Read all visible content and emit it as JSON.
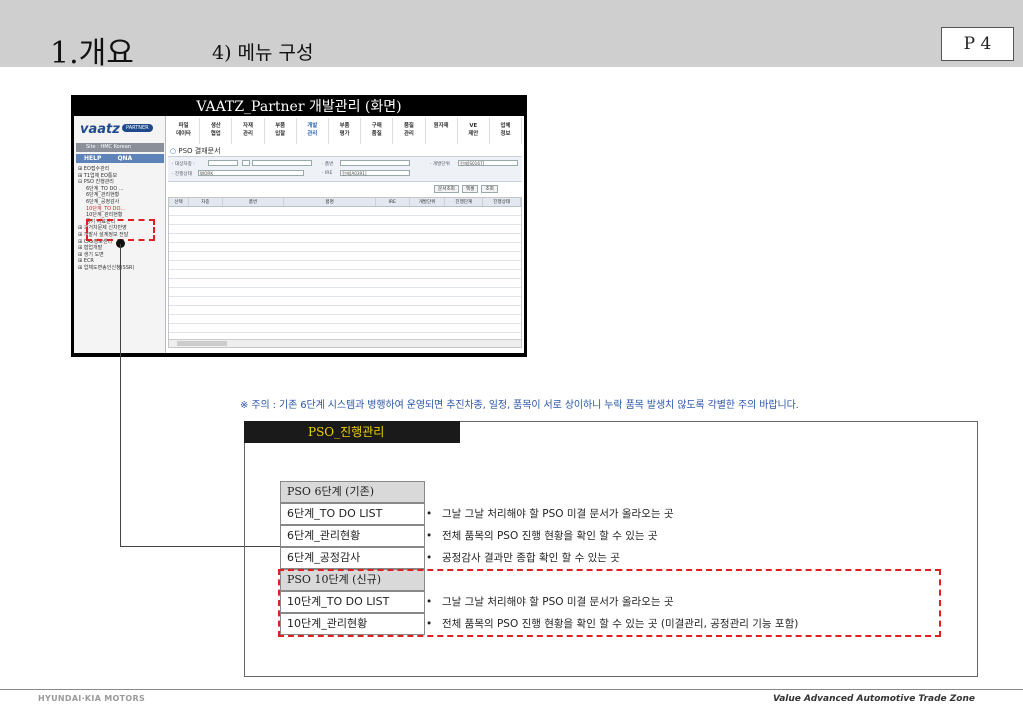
{
  "header": {
    "title": "1.개요",
    "subtitle": "4) 메뉴 구성",
    "page": "P 4"
  },
  "app": {
    "window_title": "VAATZ_Partner 개발관리 (화면)",
    "logo": "vaatz",
    "logo_tag": "PARTNER",
    "site": "Site : HMC Korean",
    "help": "HELP",
    "qna": "QNA",
    "menu": [
      "파일\n데이타",
      "생산\n협업",
      "자재\n관리",
      "부품\n입찰",
      "개발\n관리",
      "부품\n평가",
      "구매\n품질",
      "품질\n관리",
      "원자재",
      "VE\n제안",
      "업체\n정보"
    ],
    "section_title": "PSO 결재문서",
    "tree": [
      {
        "label": "⊞ EO접수관리",
        "level": 0
      },
      {
        "label": "⊞ T1업체 EO통보",
        "level": 0
      },
      {
        "label": "⊟ PSO 진행관리",
        "level": 0
      },
      {
        "label": "6단계_TO DO ...",
        "level": 1
      },
      {
        "label": "6단계_관리현황",
        "level": 1
      },
      {
        "label": "6단계_공정감사",
        "level": 1
      },
      {
        "label": "10단계_TO DO...",
        "level": 1,
        "red": true
      },
      {
        "label": "10단계_관리현황",
        "level": 1
      },
      {
        "label": "공기 자료관리",
        "level": 1
      },
      {
        "label": "⊞ 과거차문제 신차반영",
        "level": 0
      },
      {
        "label": "⊞ 개발사 설계정보 전달",
        "level": 0
      },
      {
        "label": "⊞ CAx정보센터",
        "level": 0
      },
      {
        "label": "⊞ 협업개발",
        "level": 0
      },
      {
        "label": "⊞ 생기 도면",
        "level": 0
      },
      {
        "label": "⊞ ECR",
        "level": 0
      },
      {
        "label": "⊞ 업체도면송인신청(SSR)",
        "level": 0
      }
    ],
    "filters": {
      "vehicle_label": "· 대상차종 :",
      "status_label": "· 진행상태",
      "status_value": "WORK",
      "part_label": "· 품번",
      "ire_label": "· IRE",
      "ire_value": "전체[A0391]",
      "dev_unit_label": "· 개발단위",
      "dev_unit_value": "전체[S0167]"
    },
    "buttons": [
      "문서조회",
      "엑셀",
      "조회"
    ],
    "columns": [
      "선택",
      "차종",
      "품번",
      "품명",
      "IRE",
      "개발단위",
      "진행단계",
      "진행상태"
    ]
  },
  "notice": "※ 주의 : 기존 6단계 시스템과 병행하여 운영되면 추진차종, 일정, 품목이 서로 상이하니 누락 품목 발생치 않도록 각별한 주의 바랍니다.",
  "panel": {
    "tab": "PSO_진행관리",
    "rows": [
      {
        "label": "PSO 6단계 (기존)",
        "header": true,
        "desc": ""
      },
      {
        "label": "6단계_TO DO LIST",
        "header": false,
        "desc": "그날 그날 처리해야 할 PSO 미결 문서가 올라오는 곳"
      },
      {
        "label": "6단계_관리현황",
        "header": false,
        "desc": "전체 품목의 PSO 진행 현황을 확인 할 수 있는 곳"
      },
      {
        "label": "6단계_공정감사",
        "header": false,
        "desc": "공정감사 결과만 종합 확인 할 수 있는 곳"
      },
      {
        "label": "PSO 10단계 (신규)",
        "header": true,
        "desc": ""
      },
      {
        "label": "10단계_TO DO LIST",
        "header": false,
        "desc": "그날 그날 처리해야 할 PSO 미결 문서가 올라오는 곳"
      },
      {
        "label": "10단계_관리현황",
        "header": false,
        "desc": "전체 품목의 PSO 진행 현황을 확인 할 수 있는 곳 (미결관리, 공정관리 기능 포함)"
      }
    ]
  },
  "footer": {
    "left": "HYUNDAI·KIA MOTORS",
    "right": "Value Advanced Automotive Trade Zone"
  }
}
